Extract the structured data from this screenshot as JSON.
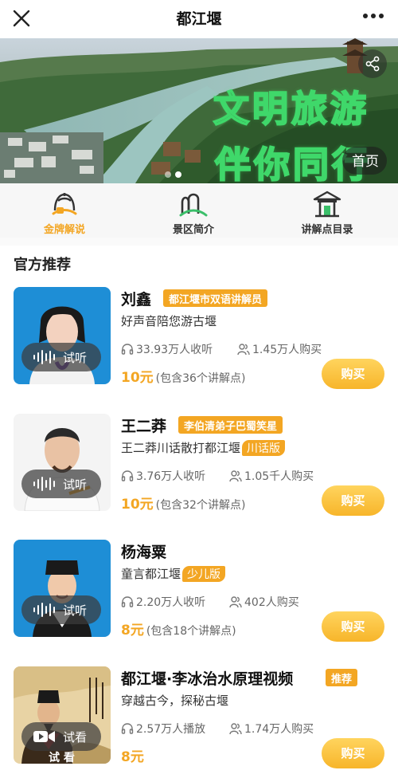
{
  "header": {
    "title": "都江堰",
    "close_icon": "close-icon",
    "more_icon": "more-icon"
  },
  "banner": {
    "slogan_line1": "文明旅游",
    "slogan_line2": "伴你同行",
    "home_label": "首页",
    "share_icon": "share-icon",
    "slide_count": 2,
    "active_slide": 2
  },
  "quick_tabs": [
    {
      "label": "金牌解说",
      "icon": "gold-guide-icon",
      "active": true
    },
    {
      "label": "景区简介",
      "icon": "scenic-intro-icon",
      "active": false
    },
    {
      "label": "讲解点目录",
      "icon": "pavilion-icon",
      "active": false
    }
  ],
  "section": {
    "title": "官方推荐"
  },
  "guides": [
    {
      "name": "刘鑫",
      "tag": "都江堰市双语讲解员",
      "subtitle": "好声音陪您游古堰",
      "subtitle_badge": "",
      "listens": "33.93万人收听",
      "buyers": "1.45万人购买",
      "price": "10元",
      "price_note": "(包含36个讲解点)",
      "action_label": "试听",
      "buy_label": "购买"
    },
    {
      "name": "王二莽",
      "tag": "李伯清弟子巴蜀笑星",
      "subtitle": "王二莽川话散打都江堰",
      "subtitle_badge": "川话版",
      "listens": "3.76万人收听",
      "buyers": "1.05千人购买",
      "price": "10元",
      "price_note": "(包含32个讲解点)",
      "action_label": "试听",
      "buy_label": "购买"
    },
    {
      "name": "杨海粟",
      "tag": "",
      "subtitle": "童言都江堰",
      "subtitle_badge": "少儿版",
      "listens": "2.20万人收听",
      "buyers": "402人购买",
      "price": "8元",
      "price_note": "(包含18个讲解点)",
      "action_label": "试听",
      "buy_label": "购买"
    },
    {
      "name": "都江堰·李冰治水原理视频",
      "tag": "推荐",
      "subtitle": "穿越古今，探秘古堰",
      "subtitle_badge": "",
      "listens": "2.57万人播放",
      "buyers": "1.74万人购买",
      "price": "8元",
      "price_note": "",
      "action_label": "试看",
      "thumb_caption": "试 看",
      "buy_label": "购买"
    }
  ],
  "colors": {
    "accent": "#f3a623",
    "banner_text": "#3fd86a",
    "thumb_blue": "#1e8ed6"
  }
}
